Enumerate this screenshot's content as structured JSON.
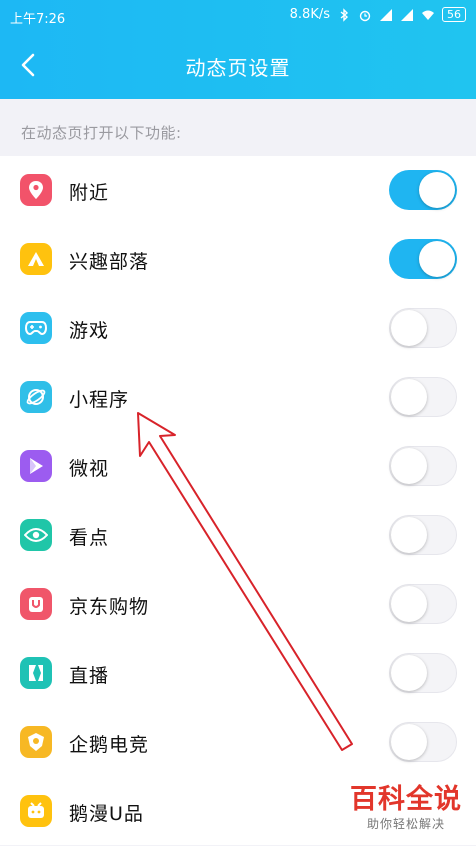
{
  "status_bar": {
    "time": "上午7:26",
    "speed": "8.8K/s",
    "battery": "56"
  },
  "header": {
    "title": "动态页设置"
  },
  "section": {
    "hint": "在动态页打开以下功能:"
  },
  "items": [
    {
      "label": "附近",
      "icon": "location-icon",
      "color": "#f2536a",
      "enabled": true
    },
    {
      "label": "兴趣部落",
      "icon": "tribe-icon",
      "color": "#ffc20e",
      "enabled": true
    },
    {
      "label": "游戏",
      "icon": "gamepad-icon",
      "color": "#2dbfee",
      "enabled": false
    },
    {
      "label": "小程序",
      "icon": "mini-program-icon",
      "color": "#30bfe8",
      "enabled": false
    },
    {
      "label": "微视",
      "icon": "play-icon",
      "color": "#9c5cf0",
      "enabled": false
    },
    {
      "label": "看点",
      "icon": "eye-icon",
      "color": "#20c6a8",
      "enabled": false
    },
    {
      "label": "京东购物",
      "icon": "jd-bag-icon",
      "color": "#f0566a",
      "enabled": false
    },
    {
      "label": "直播",
      "icon": "live-icon",
      "color": "#1fc2b5",
      "enabled": false
    },
    {
      "label": "企鹅电竞",
      "icon": "esports-icon",
      "color": "#f7b824",
      "enabled": false
    },
    {
      "label": "鹅漫U品",
      "icon": "comic-icon",
      "color": "#ffc20e",
      "enabled": false
    }
  ],
  "watermark": {
    "title": "百科全说",
    "subtitle": "助你轻松解决"
  }
}
